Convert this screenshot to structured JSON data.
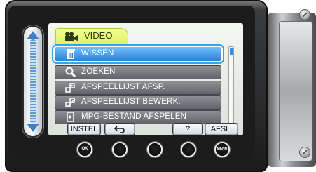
{
  "menu": {
    "tab_label": "VIDEO",
    "items": [
      {
        "label": "WISSEN",
        "icon": "trash-icon",
        "selected": true
      },
      {
        "label": "ZOEKEN",
        "icon": "magnifier-icon",
        "selected": false
      },
      {
        "label": "AFSPEELLIJST AFSP.",
        "icon": "playlist-play-icon",
        "selected": false
      },
      {
        "label": "AFSPEELLIJST BEWERK.",
        "icon": "playlist-edit-icon",
        "selected": false
      },
      {
        "label": "MPG-BESTAND AFSPELEN",
        "icon": "mpg-file-icon",
        "selected": false
      }
    ]
  },
  "softkeys": {
    "set": "INSTEL",
    "back_icon": "return-arrow-icon",
    "help": "?",
    "exit": "AFSL."
  },
  "buttons": {
    "ok": "OK",
    "menu": "MENU"
  },
  "colors": {
    "selected_row": "#2c7fd8",
    "tab": "#dff35a",
    "slider_arrow": "#3e7fc7"
  }
}
